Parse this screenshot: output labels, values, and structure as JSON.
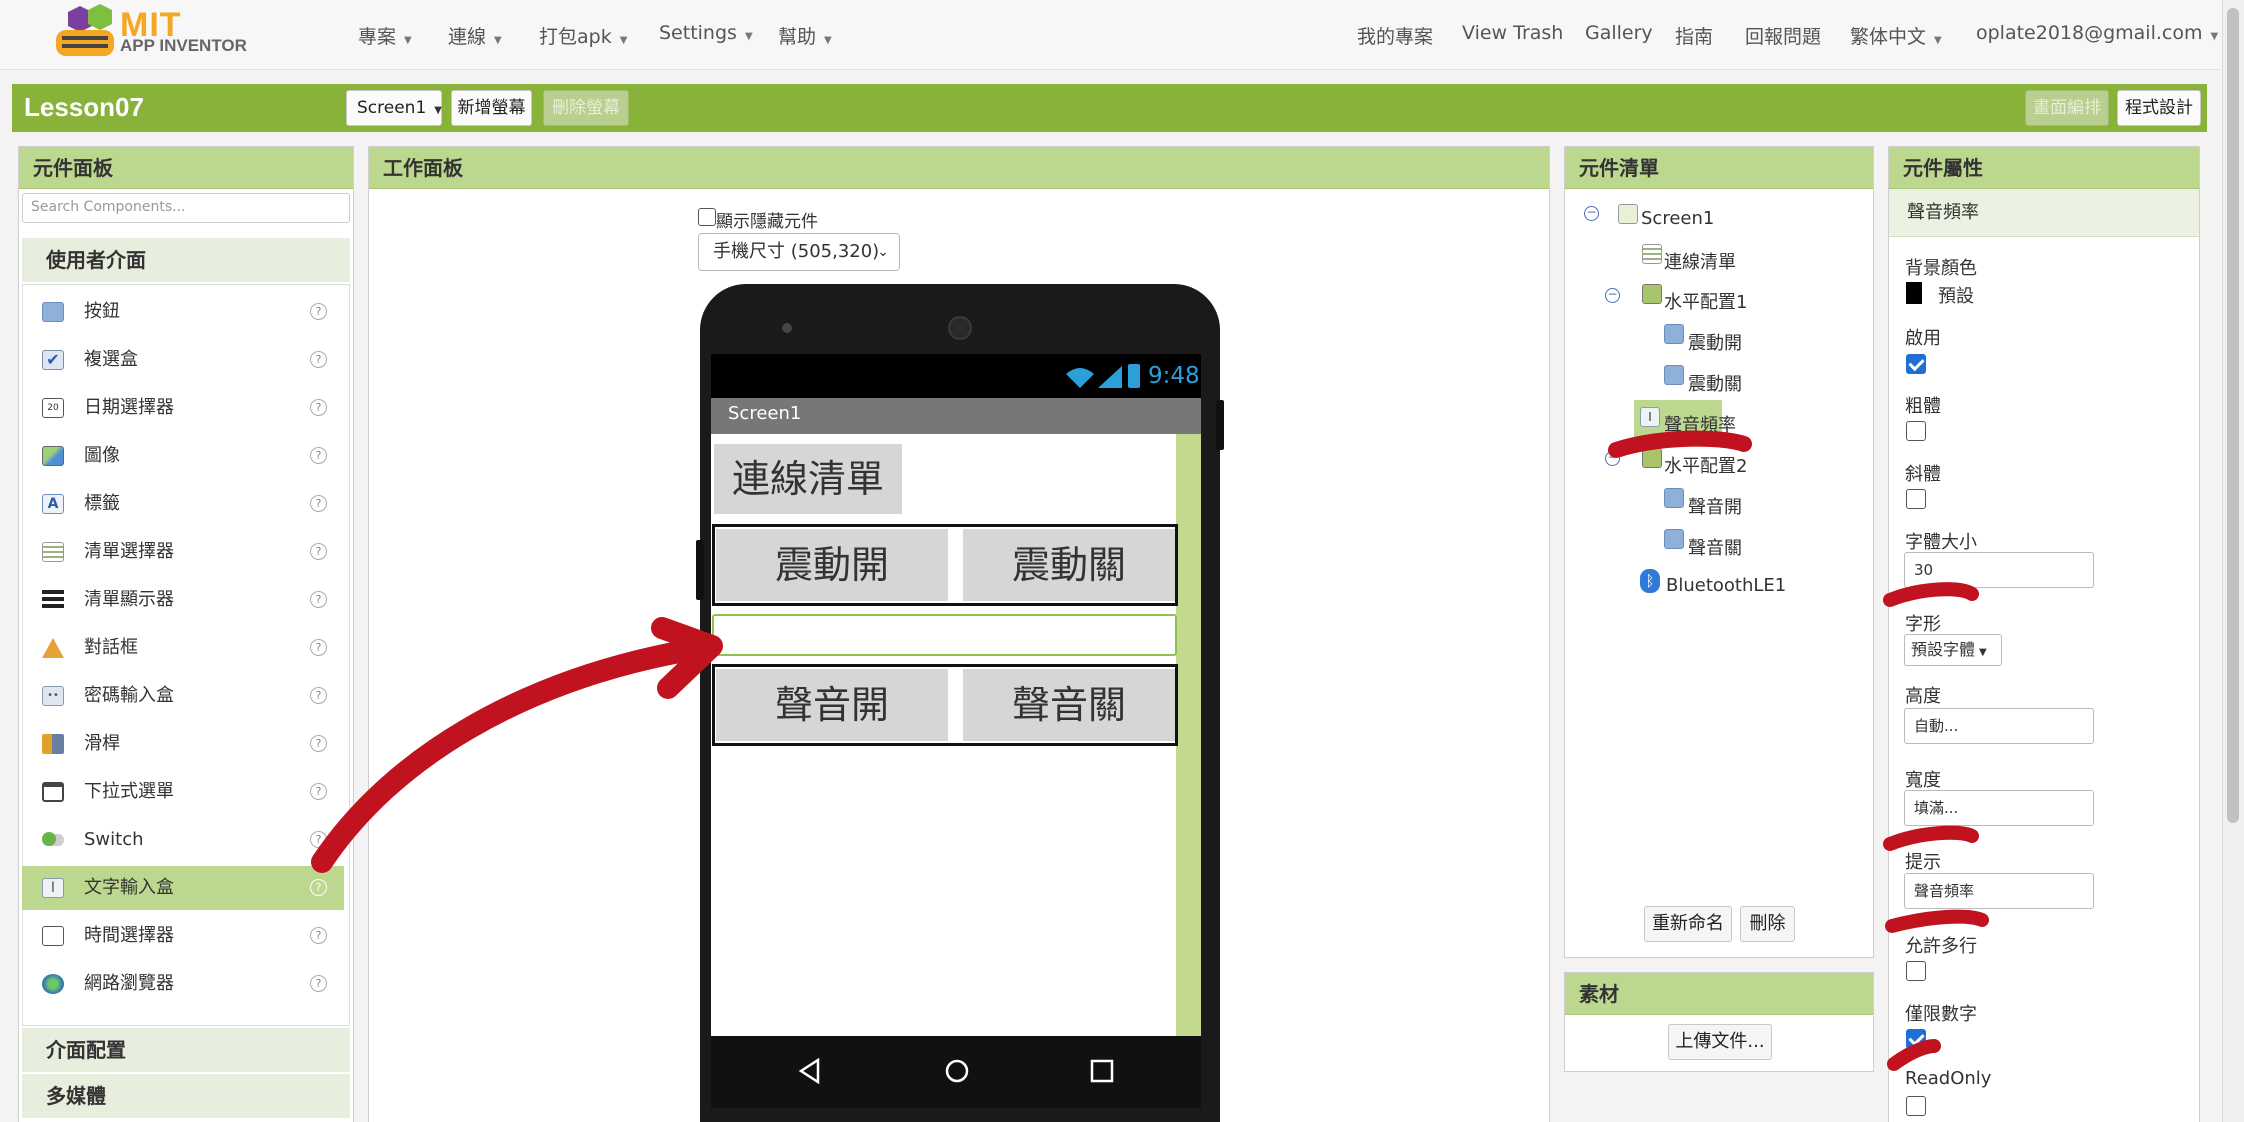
{
  "app": {
    "brand_top": "MIT",
    "brand_bottom": "APP INVENTOR"
  },
  "nav_left": [
    "專案",
    "連線",
    "打包apk",
    "Settings",
    "幫助"
  ],
  "nav_right": [
    "我的專案",
    "View Trash",
    "Gallery",
    "指南",
    "回報問題",
    "繁体中文",
    "oplate2018@gmail.com"
  ],
  "toolbar": {
    "project": "Lesson07",
    "screen_select": "Screen1",
    "add_screen": "新增螢幕",
    "remove_screen": "刪除螢幕",
    "designer": "畫面編排",
    "blocks": "程式設計"
  },
  "palette": {
    "title": "元件面板",
    "search_placeholder": "Search Components...",
    "category": "使用者介面",
    "items": [
      "按鈕",
      "複選盒",
      "日期選擇器",
      "圖像",
      "標籤",
      "清單選擇器",
      "清單顯示器",
      "對話框",
      "密碼輸入盒",
      "滑桿",
      "下拉式選單",
      "Switch",
      "文字輸入盒",
      "時間選擇器",
      "網路瀏覽器"
    ],
    "selected": "文字輸入盒",
    "cat2": "介面配置",
    "cat3": "多媒體"
  },
  "viewer": {
    "title": "工作面板",
    "hidden_toggle": "顯示隱藏元件",
    "size_select": "手機尺寸 (505,320)"
  },
  "phone": {
    "time": "9:48",
    "screen_title": "Screen1",
    "btn_list": "連線清單",
    "btn_vib_on": "震動開",
    "btn_vib_off": "震動關",
    "btn_snd_on": "聲音開",
    "btn_snd_off": "聲音關"
  },
  "components": {
    "title": "元件清單",
    "tree": [
      "Screen1",
      "連線清單",
      "水平配置1",
      "震動開",
      "震動關",
      "聲音頻率",
      "水平配置2",
      "聲音開",
      "聲音關",
      "BluetoothLE1"
    ],
    "rename": "重新命名",
    "delete": "刪除"
  },
  "media": {
    "title": "素材",
    "upload": "上傳文件..."
  },
  "properties": {
    "title": "元件屬性",
    "component": "聲音頻率",
    "bg_label": "背景顏色",
    "bg_value": "預設",
    "bg_color": "#000000",
    "enabled_label": "啟用",
    "bold_label": "粗體",
    "italic_label": "斜體",
    "fontsize_label": "字體大小",
    "fontsize_value": "30",
    "font_label": "字形",
    "font_value": "預設字體",
    "height_label": "高度",
    "height_value": "自動...",
    "width_label": "寬度",
    "width_value": "填滿...",
    "hint_label": "提示",
    "hint_value": "聲音頻率",
    "multiline_label": "允許多行",
    "numbers_label": "僅限數字",
    "readonly_label": "ReadOnly"
  },
  "colors": {
    "accent": "#89b23b",
    "panel_head": "#bcd88e",
    "annotation": "#c1121f"
  }
}
